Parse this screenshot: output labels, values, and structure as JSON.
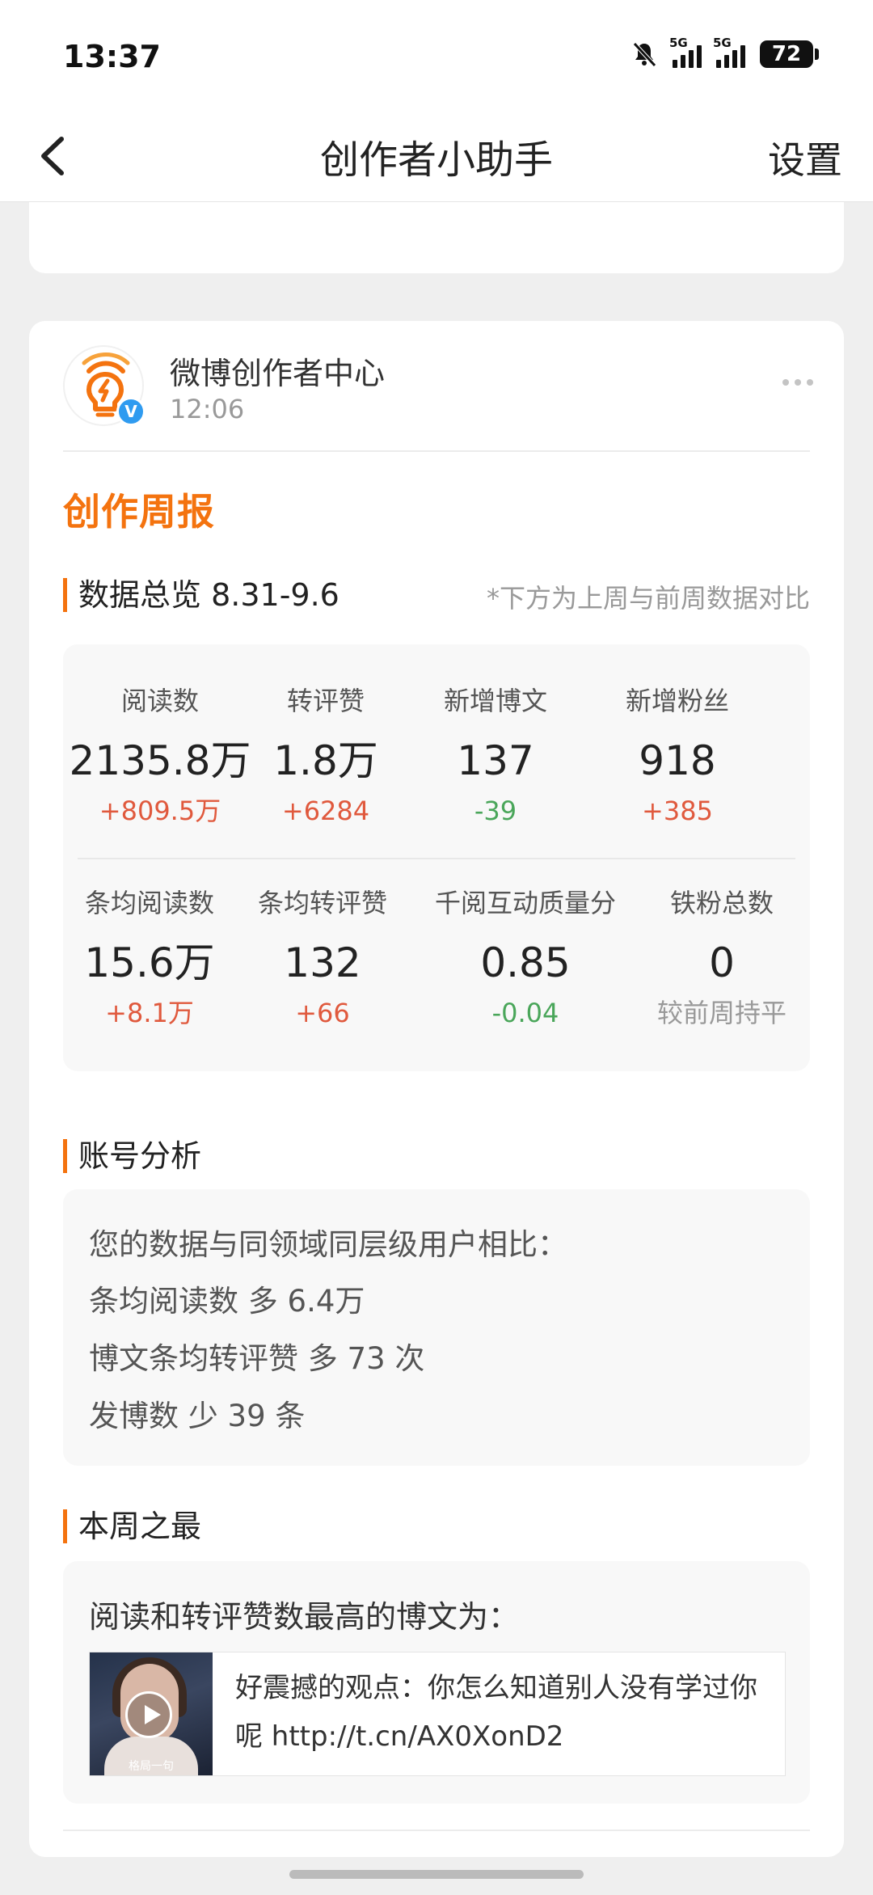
{
  "status_bar": {
    "time": "13:37",
    "battery": "72",
    "signal1_tag": "5G",
    "signal2_tag": "5G"
  },
  "nav": {
    "title": "创作者小助手",
    "settings": "设置"
  },
  "account": {
    "name": "微博创作者中心",
    "time": "12:06",
    "verified_mark": "V"
  },
  "report": {
    "title": "创作周报"
  },
  "overview": {
    "heading": "数据总览 8.31-9.6",
    "note": "*下方为上周与前周数据对比",
    "row1": [
      {
        "label": "阅读数",
        "value": "2135.8万",
        "change": "+809.5万",
        "trend": "up"
      },
      {
        "label": "转评赞",
        "value": "1.8万",
        "change": "+6284",
        "trend": "up"
      },
      {
        "label": "新增博文",
        "value": "137",
        "change": "-39",
        "trend": "down"
      },
      {
        "label": "新增粉丝",
        "value": "918",
        "change": "+385",
        "trend": "up"
      }
    ],
    "row2": [
      {
        "label": "条均阅读数",
        "value": "15.6万",
        "change": "+8.1万",
        "trend": "up"
      },
      {
        "label": "条均转评赞",
        "value": "132",
        "change": "+66",
        "trend": "up"
      },
      {
        "label": "千阅互动质量分",
        "value": "0.85",
        "change": "-0.04",
        "trend": "down"
      },
      {
        "label": "铁粉总数",
        "value": "0",
        "change": "较前周持平",
        "trend": "flat"
      }
    ]
  },
  "analysis": {
    "heading": "账号分析",
    "lines": [
      "您的数据与同领域同层级用户相比：",
      "条均阅读数 多 6.4万",
      "博文条均转评赞 多 73 次",
      "发博数 少 39 条"
    ]
  },
  "best": {
    "heading": "本周之最",
    "intro": "阅读和转评赞数最高的博文为：",
    "post_text": "好震撼的观点：你怎么知道别人没有学过你呢 http://t.cn/AX0XonD2",
    "thumb_caption": "格局一句"
  },
  "colors": {
    "accent": "#f4730f",
    "up": "#e0593d",
    "down": "#4aa65a",
    "verified": "#2f9bf0"
  }
}
